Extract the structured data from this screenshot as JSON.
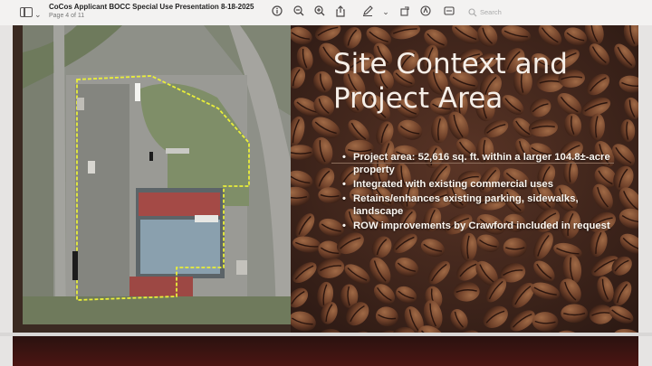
{
  "toolbar": {
    "title": "CoCos Applicant BOCC Special Use Presentation 8-18-2025",
    "page_indicator": "Page 4 of 11",
    "search_placeholder": "Search",
    "icons": [
      "sidebar-icon",
      "chevron-down-icon",
      "info-icon",
      "zoom-out-icon",
      "zoom-in-icon",
      "share-icon",
      "markup-pen-icon",
      "chevron-down-icon",
      "rotate-icon",
      "markup-circle-icon",
      "form-icon",
      "search-icon"
    ]
  },
  "slide": {
    "title_line1": "Site Context and",
    "title_line2": "Project Area",
    "bullets": [
      "Project area: 52,616 sq. ft. within a larger 104.8±-acre property",
      "Integrated with existing commercial uses",
      "Retains/enhances existing parking, sidewalks, landscape",
      "ROW improvements by Crawford included in request"
    ]
  },
  "colors": {
    "boundary": "#e9ee3a",
    "title_text": "#f6efe8",
    "bean_dark": "#3b2218",
    "bean_light": "#8a5a3c"
  }
}
